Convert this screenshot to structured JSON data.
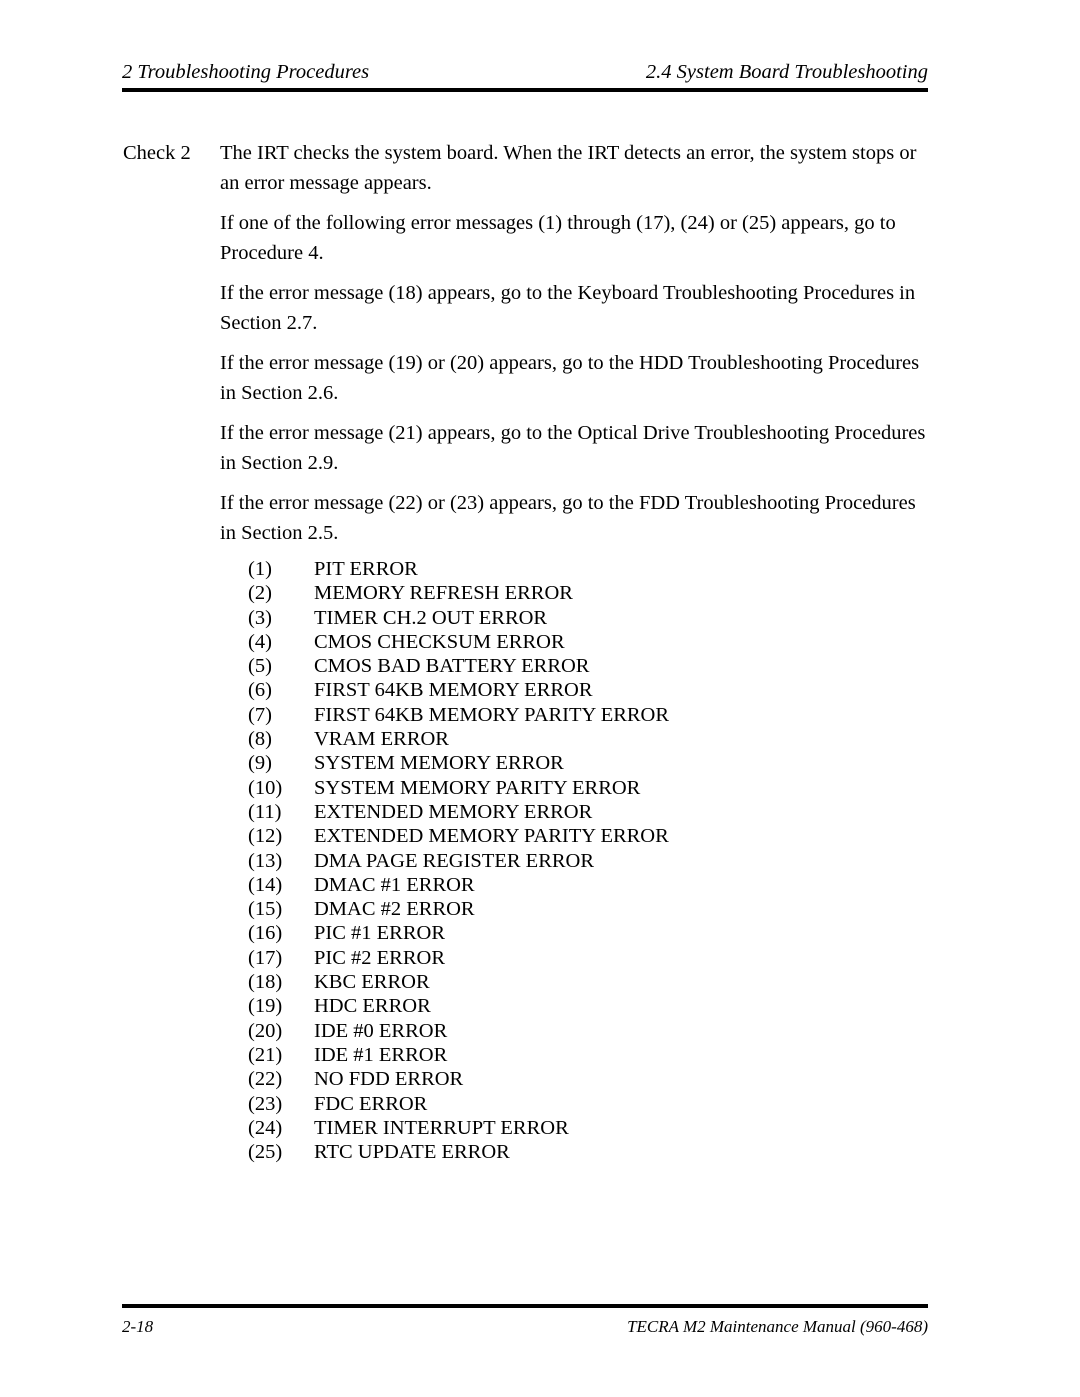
{
  "header": {
    "left": "2  Troubleshooting Procedures",
    "right": "2.4 System Board Troubleshooting"
  },
  "body": {
    "check_label": "Check 2",
    "paragraphs": [
      "The IRT checks the system board. When the IRT detects an error, the system stops or an error message appears.",
      "If one of the following error messages (1) through (17), (24) or (25) appears, go to Procedure 4.",
      "If the error message (18) appears, go to the Keyboard Troubleshooting Procedures in Section 2.7.",
      "If the error message (19) or (20) appears, go to the HDD Troubleshooting Procedures in Section 2.6.",
      "If the error message (21) appears, go to the Optical Drive Troubleshooting Procedures in Section 2.9.",
      "If the error message (22) or (23) appears, go to the FDD Troubleshooting Procedures in Section 2.5."
    ]
  },
  "error_list": [
    {
      "num": "(1)",
      "text": "PIT ERROR"
    },
    {
      "num": "(2)",
      "text": "MEMORY REFRESH ERROR"
    },
    {
      "num": "(3)",
      "text": "TIMER CH.2 OUT ERROR"
    },
    {
      "num": "(4)",
      "text": "CMOS CHECKSUM ERROR"
    },
    {
      "num": "(5)",
      "text": "CMOS BAD BATTERY ERROR"
    },
    {
      "num": "(6)",
      "text": "FIRST 64KB MEMORY ERROR"
    },
    {
      "num": "(7)",
      "text": "FIRST 64KB MEMORY PARITY ERROR"
    },
    {
      "num": "(8)",
      "text": "VRAM ERROR"
    },
    {
      "num": "(9)",
      "text": "SYSTEM MEMORY ERROR"
    },
    {
      "num": "(10)",
      "text": "SYSTEM MEMORY PARITY ERROR"
    },
    {
      "num": "(11)",
      "text": "EXTENDED MEMORY ERROR"
    },
    {
      "num": "(12)",
      "text": "EXTENDED MEMORY PARITY ERROR"
    },
    {
      "num": "(13)",
      "text": "DMA PAGE REGISTER ERROR"
    },
    {
      "num": "(14)",
      "text": "DMAC #1 ERROR"
    },
    {
      "num": "(15)",
      "text": "DMAC #2 ERROR"
    },
    {
      "num": "(16)",
      "text": "PIC #1 ERROR"
    },
    {
      "num": "(17)",
      "text": "PIC #2 ERROR"
    },
    {
      "num": "(18)",
      "text": "KBC ERROR"
    },
    {
      "num": "(19)",
      "text": "HDC ERROR"
    },
    {
      "num": "(20)",
      "text": "IDE #0 ERROR"
    },
    {
      "num": "(21)",
      "text": "IDE #1 ERROR"
    },
    {
      "num": "(22)",
      "text": "NO FDD ERROR"
    },
    {
      "num": "(23)",
      "text": "FDC ERROR"
    },
    {
      "num": "(24)",
      "text": "TIMER INTERRUPT ERROR"
    },
    {
      "num": "(25)",
      "text": "RTC UPDATE ERROR"
    }
  ],
  "footer": {
    "left": "2-18",
    "right": "TECRA M2 Maintenance Manual (960-468)"
  },
  "colors": {
    "text": "#000000",
    "page_background": "#ffffff",
    "rule": "#000000"
  }
}
